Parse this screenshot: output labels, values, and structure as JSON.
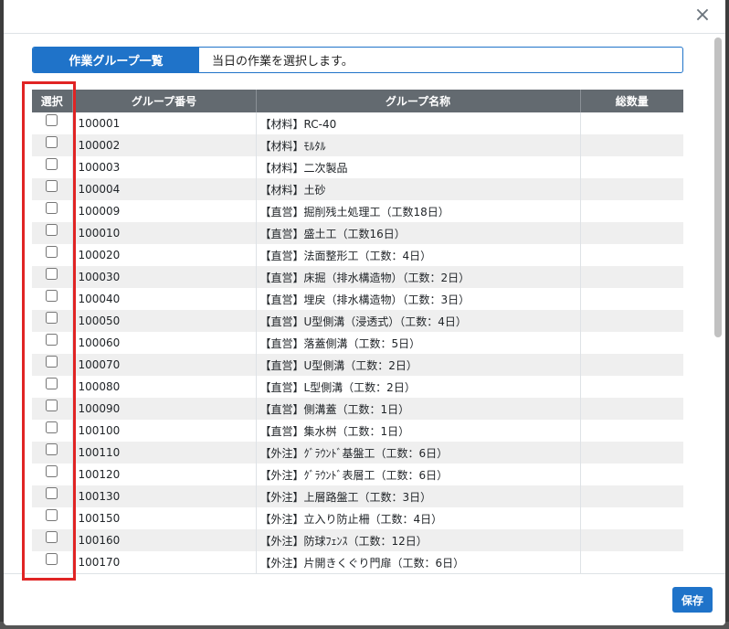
{
  "header": {
    "close_label": "×"
  },
  "title": {
    "label": "作業グループ一覧",
    "description": "当日の作業を選択します。"
  },
  "table": {
    "columns": [
      "選択",
      "グループ番号",
      "グループ名称",
      "総数量"
    ],
    "rows": [
      {
        "code": "100001",
        "name": "【材料】RC-40",
        "qty": ""
      },
      {
        "code": "100002",
        "name": "【材料】ﾓﾙﾀﾙ",
        "qty": ""
      },
      {
        "code": "100003",
        "name": "【材料】二次製品",
        "qty": ""
      },
      {
        "code": "100004",
        "name": "【材料】土砂",
        "qty": ""
      },
      {
        "code": "100009",
        "name": "【直営】掘削残土処理工（工数18日）",
        "qty": ""
      },
      {
        "code": "100010",
        "name": "【直営】盛土工（工数16日）",
        "qty": ""
      },
      {
        "code": "100020",
        "name": "【直営】法面整形工（工数：4日）",
        "qty": ""
      },
      {
        "code": "100030",
        "name": "【直営】床掘（排水構造物）（工数：2日）",
        "qty": ""
      },
      {
        "code": "100040",
        "name": "【直営】埋戻（排水構造物）（工数：3日）",
        "qty": ""
      },
      {
        "code": "100050",
        "name": "【直営】U型側溝（浸透式）（工数：4日）",
        "qty": ""
      },
      {
        "code": "100060",
        "name": "【直営】落蓋側溝（工数：5日）",
        "qty": ""
      },
      {
        "code": "100070",
        "name": "【直営】U型側溝（工数：2日）",
        "qty": ""
      },
      {
        "code": "100080",
        "name": "【直営】L型側溝（工数：2日）",
        "qty": ""
      },
      {
        "code": "100090",
        "name": "【直営】側溝蓋（工数：1日）",
        "qty": ""
      },
      {
        "code": "100100",
        "name": "【直営】集水桝（工数：1日）",
        "qty": ""
      },
      {
        "code": "100110",
        "name": "【外注】ｸﾞﾗｳﾝﾄﾞ基盤工（工数：6日）",
        "qty": ""
      },
      {
        "code": "100120",
        "name": "【外注】ｸﾞﾗｳﾝﾄﾞ表層工（工数：6日）",
        "qty": ""
      },
      {
        "code": "100130",
        "name": "【外注】上層路盤工（工数：3日）",
        "qty": ""
      },
      {
        "code": "100150",
        "name": "【外注】立入り防止柵（工数：4日）",
        "qty": ""
      },
      {
        "code": "100160",
        "name": "【外注】防球ﾌｪﾝｽ（工数：12日）",
        "qty": ""
      },
      {
        "code": "100170",
        "name": "【外注】片開きくぐり門扉（工数：6日）",
        "qty": ""
      }
    ]
  },
  "footer": {
    "save_label": "保存"
  },
  "colors": {
    "accent": "#1f73c9",
    "table_header": "#636a70",
    "highlight": "#e02424",
    "row_stripe": "#efefef"
  }
}
